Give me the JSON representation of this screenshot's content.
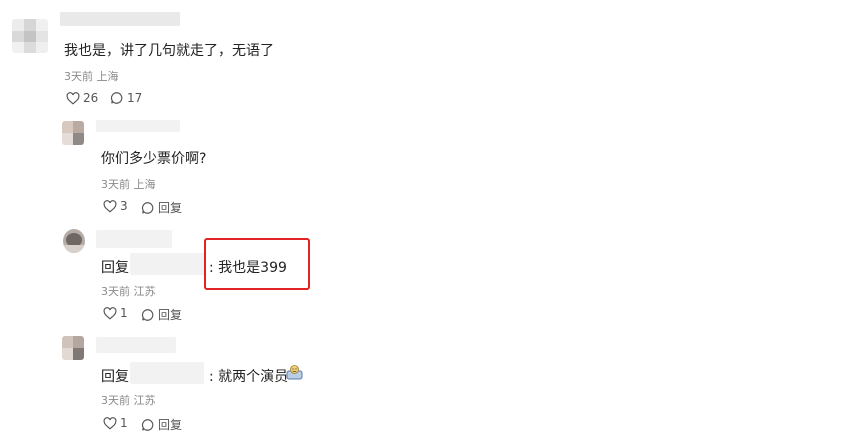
{
  "comments": [
    {
      "text": "我也是，讲了几句就走了，无语了",
      "time": "3天前",
      "location": "上海",
      "likes": "26",
      "replies": "17"
    },
    {
      "text": "你们多少票价啊?",
      "time": "3天前",
      "location": "上海",
      "likes": "3",
      "reply_label": "回复"
    },
    {
      "prefix": "回复",
      "text": ": 我也是399",
      "time": "3天前",
      "location": "江苏",
      "likes": "1",
      "reply_label": "回复"
    },
    {
      "prefix": "回复",
      "text": ": 就两个演员",
      "time": "3天前",
      "location": "江苏",
      "likes": "1",
      "reply_label": "回复"
    }
  ],
  "colors": {
    "highlight": "#e02424",
    "meta_text": "#8a8a8a"
  },
  "icons": [
    "heart-icon",
    "comment-icon",
    "emoji-icon"
  ]
}
